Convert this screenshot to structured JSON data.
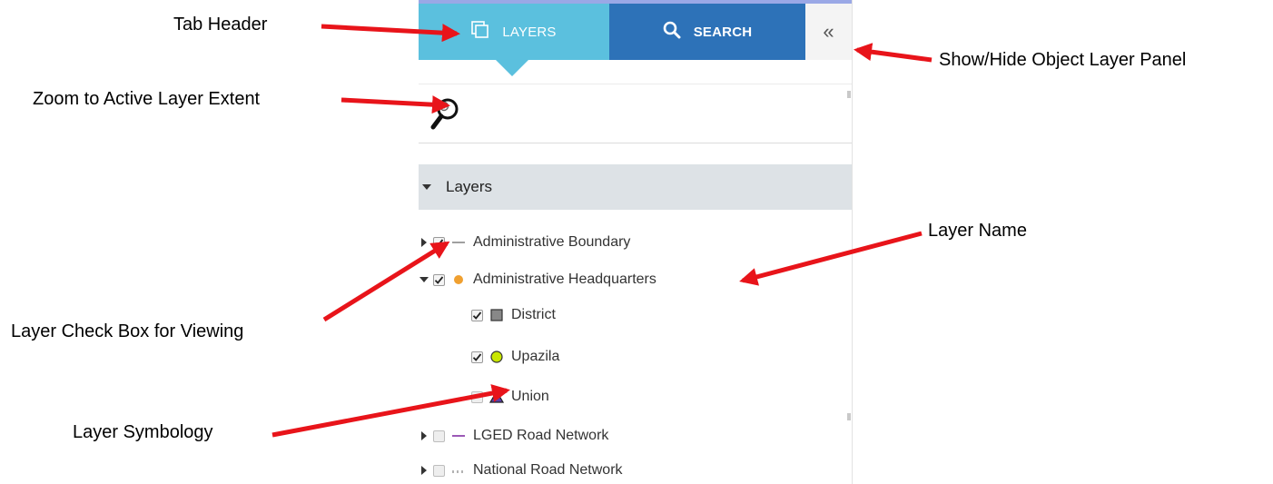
{
  "tabs": {
    "layers_label": "LAYERS",
    "search_label": "SEARCH",
    "collapse_glyph": "«",
    "layers_icon": "layers-icon",
    "search_icon": "search-icon"
  },
  "toolbar": {
    "zoom_icon": "zoom-to-extent-icon"
  },
  "layers_section": {
    "title": "Layers",
    "items": [
      {
        "label": "Administrative Boundary",
        "checked": true,
        "expander": "collapsed",
        "symbol": "line",
        "symbol_color": "#a0a0a0"
      },
      {
        "label": "Administrative Headquarters",
        "checked": true,
        "expander": "expanded",
        "symbol": "dot",
        "symbol_color": "#f0a030"
      },
      {
        "label": "District",
        "checked": true,
        "expander": "none",
        "symbol": "square",
        "symbol_color": "#888888"
      },
      {
        "label": "Upazila",
        "checked": true,
        "expander": "none",
        "symbol": "circle",
        "symbol_color": "#c8e600"
      },
      {
        "label": "Union",
        "checked": false,
        "expander": "none",
        "symbol": "triangle",
        "symbol_color": "#5b3fa8"
      },
      {
        "label": "LGED Road Network",
        "checked": false,
        "expander": "collapsed",
        "symbol": "line",
        "symbol_color": "#9b59b6"
      },
      {
        "label": "National Road Network",
        "checked": false,
        "expander": "collapsed",
        "symbol": "dotted-line",
        "symbol_color": "#a0a0a0"
      }
    ]
  },
  "annotations": {
    "tab_header": "Tab Header",
    "zoom_extent": "Zoom to Active Layer Extent",
    "show_hide": "Show/Hide Object Layer Panel",
    "layer_name": "Layer Name",
    "check_box": "Layer Check Box for Viewing",
    "symbology": "Layer Symbology"
  },
  "colors": {
    "tab_active": "#5bc0de",
    "tab_inactive": "#2d72b8",
    "arrow": "#e8141a"
  }
}
